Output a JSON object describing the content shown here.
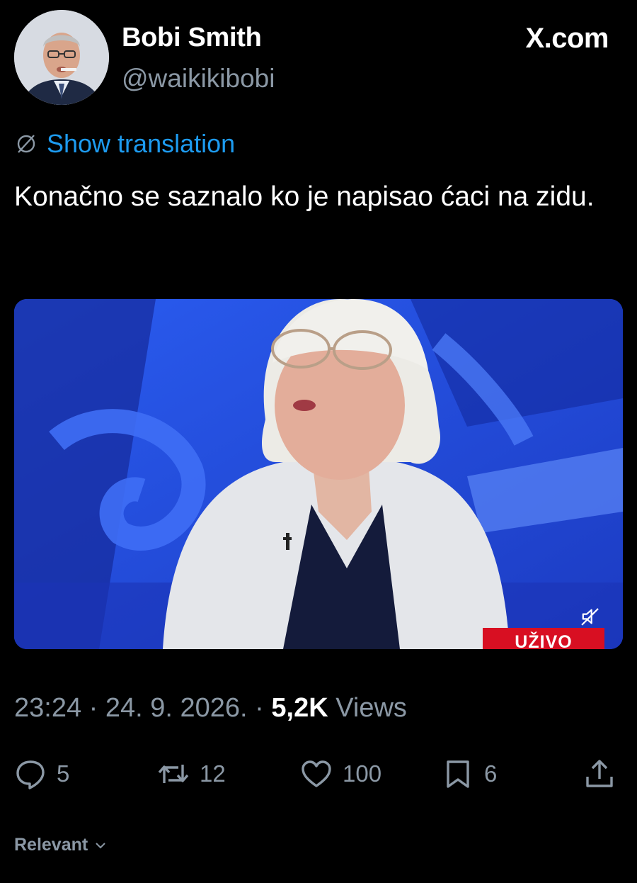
{
  "author": {
    "display_name": "Bobi Smith",
    "handle": "@waikikibobi"
  },
  "site_mark": "X.com",
  "translation": {
    "label": "Show translation"
  },
  "tweet": {
    "text": "Konačno se saznalo ko je napisao ćaci na zidu."
  },
  "media": {
    "live_label": "UŽIVO",
    "mute_icon": "speaker-muted-icon"
  },
  "meta": {
    "time": "23:24",
    "separator": "·",
    "date": "24. 9. 2026.",
    "views_count": "5,2K",
    "views_label": "Views"
  },
  "actions": {
    "replies": "5",
    "reposts": "12",
    "likes": "100",
    "bookmarks": "6"
  },
  "sort": {
    "label": "Relevant"
  },
  "colors": {
    "background": "#000000",
    "link": "#1d9bf0",
    "secondary_text": "#8b98a5",
    "primary_text": "#ffffff",
    "live_red": "#d80f22"
  }
}
